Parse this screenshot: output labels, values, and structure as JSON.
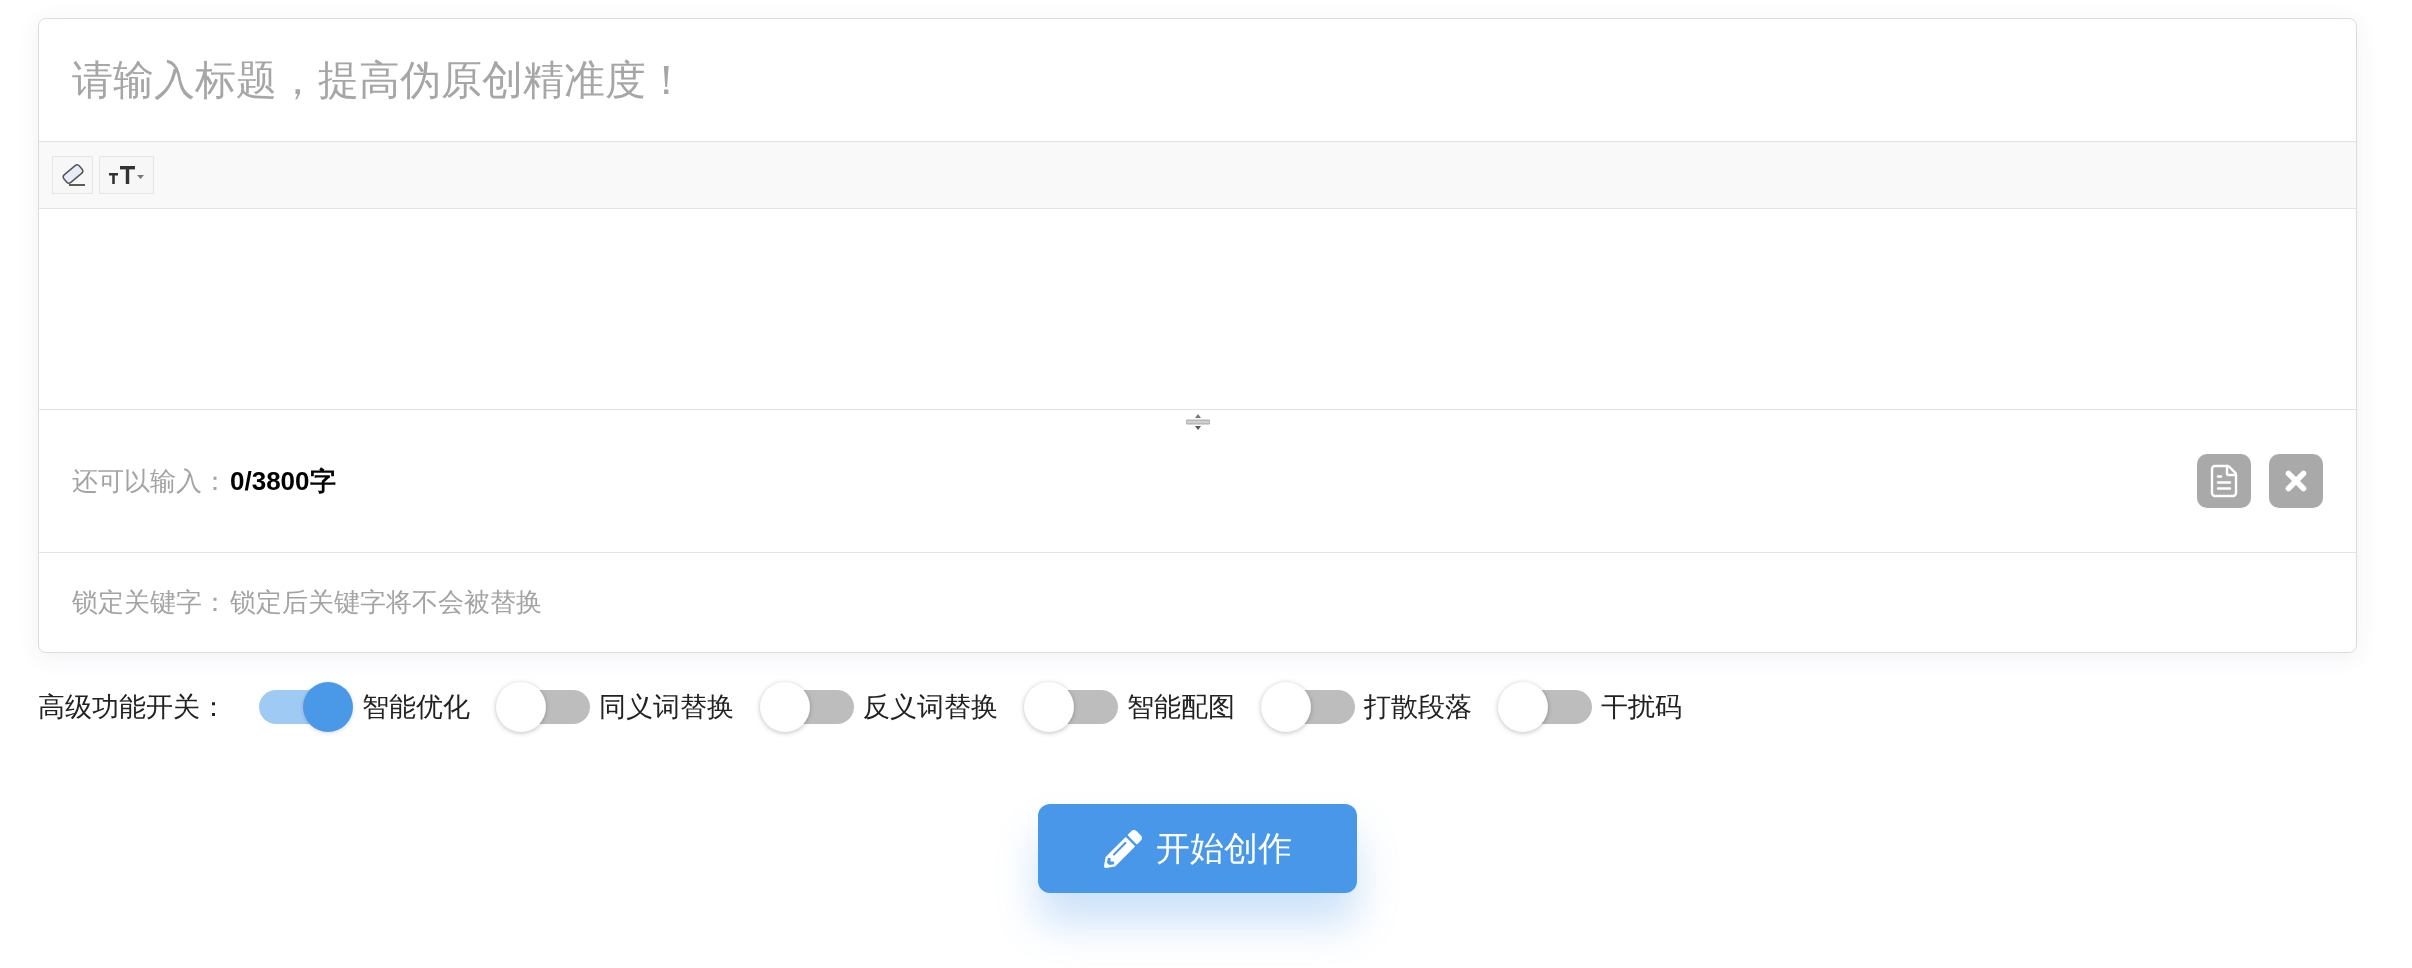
{
  "title_field": {
    "placeholder": "请输入标题，提高伪原创精准度！"
  },
  "count": {
    "label": "还可以输入：",
    "value": "0/3800字"
  },
  "keyword_lock": {
    "label": "锁定关键字：",
    "placeholder": "锁定后关键字将不会被替换"
  },
  "features": {
    "label": "高级功能开关：",
    "switches": [
      {
        "label": "智能优化",
        "on": true
      },
      {
        "label": "同义词替换",
        "on": false
      },
      {
        "label": "反义词替换",
        "on": false
      },
      {
        "label": "智能配图",
        "on": false
      },
      {
        "label": "打散段落",
        "on": false
      },
      {
        "label": "干扰码",
        "on": false
      }
    ]
  },
  "submit_button": {
    "label": "开始创作"
  }
}
